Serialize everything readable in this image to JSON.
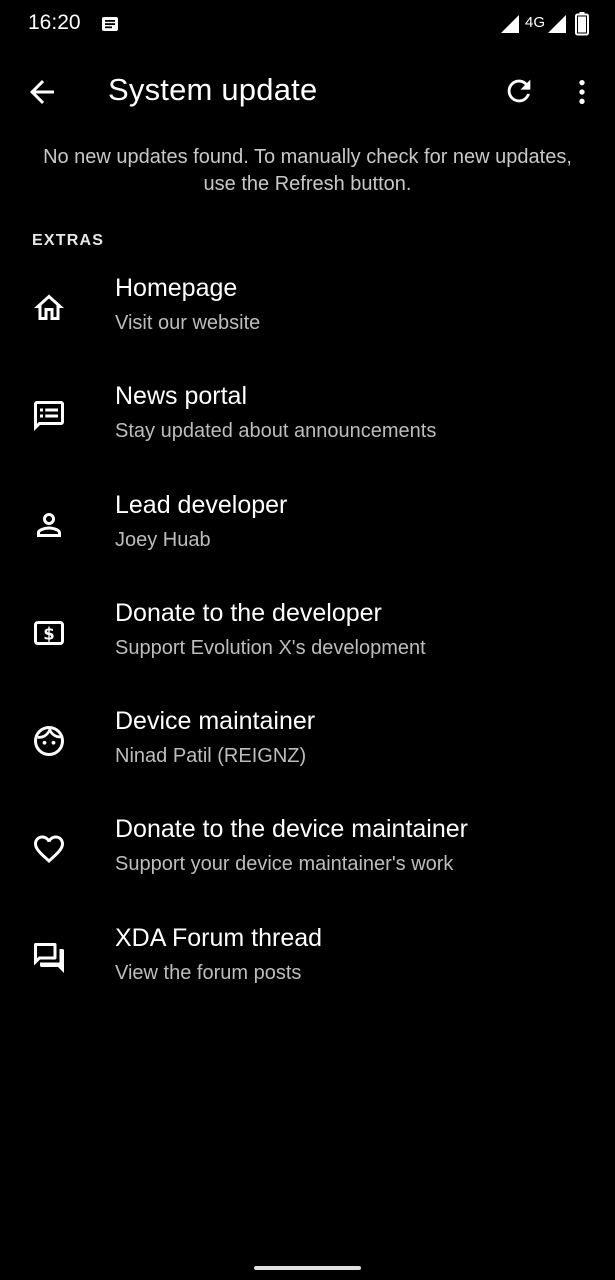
{
  "status_bar": {
    "time": "16:20",
    "network": "4G",
    "icons": [
      "notification-icon",
      "signal-icon",
      "signal-icon",
      "battery-icon"
    ]
  },
  "app_bar": {
    "title": "System update",
    "icons": [
      "back-arrow-icon",
      "refresh-icon",
      "more-vert-icon"
    ]
  },
  "message": "No new updates found. To manually check for new updates, use the Refresh button.",
  "section": {
    "header": "EXTRAS",
    "items": [
      {
        "icon": "home-icon",
        "title": "Homepage",
        "subtitle": "Visit our website"
      },
      {
        "icon": "news-icon",
        "title": "News portal",
        "subtitle": "Stay updated about announcements"
      },
      {
        "icon": "person-icon",
        "title": "Lead developer",
        "subtitle": "Joey Huab"
      },
      {
        "icon": "money-icon",
        "title": "Donate to the developer",
        "subtitle": "Support Evolution X's development"
      },
      {
        "icon": "face-icon",
        "title": "Device maintainer",
        "subtitle": "Ninad Patil (REIGNZ)"
      },
      {
        "icon": "heart-icon",
        "title": "Donate to the device maintainer",
        "subtitle": "Support your device maintainer's work"
      },
      {
        "icon": "forum-icon",
        "title": "XDA Forum thread",
        "subtitle": "View the forum posts"
      }
    ]
  },
  "colors": {
    "background": "#000000",
    "text_primary": "#ffffff",
    "text_secondary": "#bdbdbd"
  }
}
